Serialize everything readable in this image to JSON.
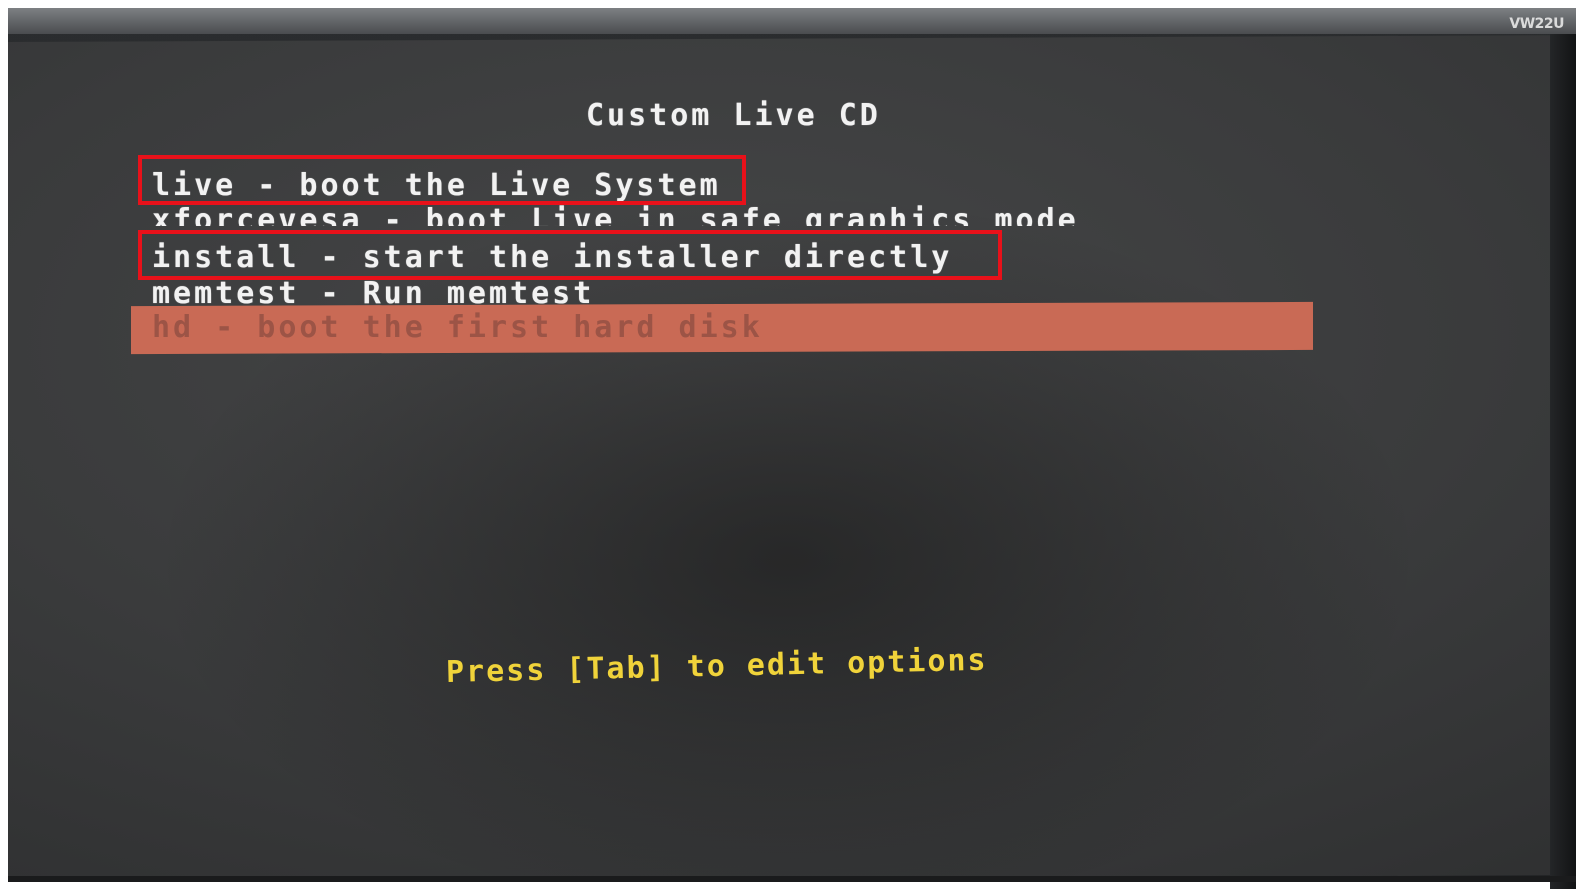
{
  "monitor": {
    "brand_label": "VW22U"
  },
  "boot_menu": {
    "title": "Custom Live CD",
    "items": [
      {
        "label": "live - boot the Live System",
        "annotated": true
      },
      {
        "label": "xforcevesa - boot Live in safe graphics mode",
        "annotated": false
      },
      {
        "label": "install - start the installer directly",
        "annotated": true
      },
      {
        "label": "memtest - Run memtest",
        "annotated": false
      },
      {
        "label": "hd - boot the first hard disk",
        "annotated": false,
        "selected": true
      }
    ],
    "footer_hint": "Press [Tab] to edit options"
  },
  "colors": {
    "screen_background": "#3a3b3c",
    "menu_text": "#f2f2f2",
    "selection_bar": "#c96a55",
    "selected_text": "#9c5446",
    "hint_text": "#f0d33a",
    "annotation_box": "#e8111a"
  }
}
